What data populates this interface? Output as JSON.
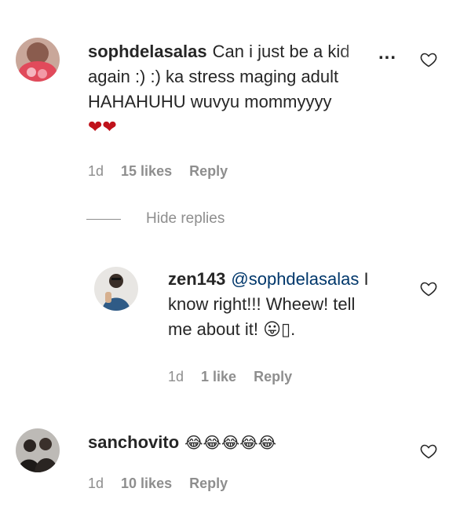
{
  "comments": [
    {
      "username": "sophdelasalas",
      "line1": "Can i just be a kid",
      "line2": "again :) :) ka stress maging adult",
      "line3": "HAHAHUHU wuvyu mommyyyy",
      "hearts": "❤❤",
      "time": "1d",
      "likes": "15 likes",
      "reply": "Reply",
      "more": "..."
    },
    {
      "username": "zen143",
      "mention": "@sophdelasalas",
      "line1_tail": "I",
      "line2": "know right!!! Wheew! tell",
      "line3": "me about it! 😛▯.",
      "time": "1d",
      "likes": "1 like",
      "reply": "Reply"
    },
    {
      "username": "sanchovito",
      "text": "😂😂😂😂😂",
      "time": "1d",
      "likes": "10 likes",
      "reply": "Reply"
    }
  ],
  "hide_replies": "Hide replies",
  "colors": {
    "text": "#262626",
    "muted": "#8e8e8e",
    "mention": "#00376b",
    "heart": "#c0121b"
  },
  "icons": [
    "heart-outline-icon"
  ]
}
